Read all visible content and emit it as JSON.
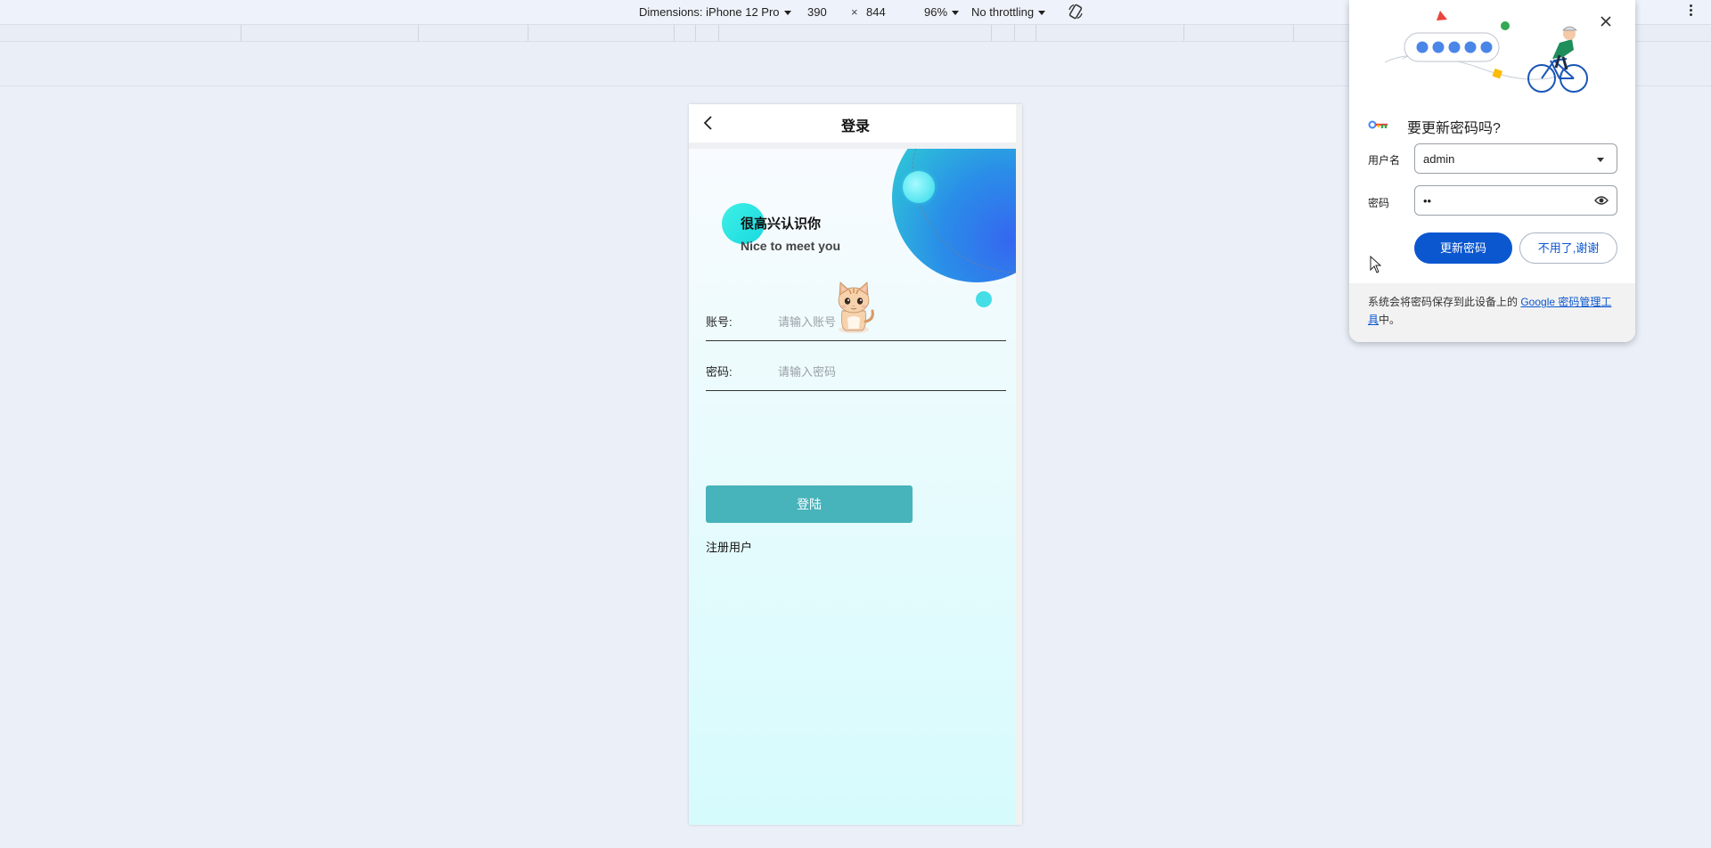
{
  "devtools": {
    "dimensions_label": "Dimensions: iPhone 12 Pro",
    "width": "390",
    "times": "×",
    "height": "844",
    "zoom": "96%",
    "throttling": "No throttling"
  },
  "page": {
    "title": "登录",
    "greeting_cn": "很高兴认识你",
    "greeting_en": "Nice to meet you",
    "account_label": "账号:",
    "account_placeholder": "请输入账号",
    "password_label": "密码:",
    "password_placeholder": "请输入密码",
    "login_button": "登陆",
    "register_link": "注册用户"
  },
  "popup": {
    "title": "要更新密码吗?",
    "username_label": "用户名",
    "username_value": "admin",
    "password_label": "密码",
    "password_value": "••",
    "update_button": "更新密码",
    "decline_button": "不用了,谢谢",
    "footer_text": "系统会将密码保存到此设备上的 ",
    "footer_link": "Google 密码管理工具",
    "footer_end": "中。"
  },
  "colors": {
    "accent_button": "#47b3ba",
    "chrome_blue": "#0b57d0"
  }
}
